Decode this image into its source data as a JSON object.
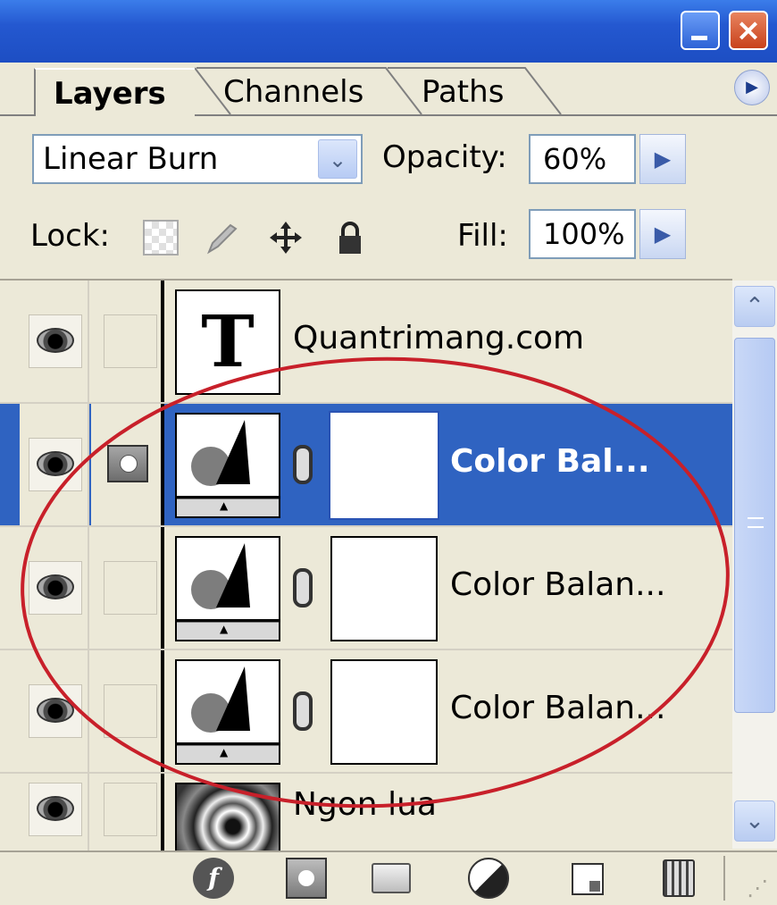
{
  "tabs": [
    {
      "label": "Layers",
      "active": true
    },
    {
      "label": "Channels",
      "active": false
    },
    {
      "label": "Paths",
      "active": false
    }
  ],
  "blend_mode": {
    "value": "Linear Burn"
  },
  "opacity": {
    "label": "Opacity:",
    "value": "60%"
  },
  "lock": {
    "label": "Lock:"
  },
  "fill": {
    "label": "Fill:",
    "value": "100%"
  },
  "layers": [
    {
      "name": "Quantrimang.com",
      "type": "text",
      "thumb_glyph": "T",
      "visible": true,
      "selected": false
    },
    {
      "name": "Color Bal...",
      "type": "adjustment",
      "visible": true,
      "selected": true
    },
    {
      "name": "Color Balan...",
      "type": "adjustment",
      "visible": true,
      "selected": false
    },
    {
      "name": "Color Balan...",
      "type": "adjustment",
      "visible": true,
      "selected": false
    },
    {
      "name": "Ngon lua",
      "type": "image",
      "visible": true,
      "selected": false
    }
  ],
  "icons": {
    "minimize": "minimize-icon",
    "close": "close-icon",
    "panel_menu": "panel-menu-icon",
    "lock_transparent": "lock-transparent-pixels-icon",
    "lock_image": "lock-image-pixels-icon",
    "lock_position": "lock-position-icon",
    "lock_all": "lock-all-icon",
    "fx": "layer-style-icon",
    "add_mask": "add-mask-icon",
    "new_group": "new-group-icon",
    "adjustment": "new-adjustment-layer-icon",
    "new_layer": "new-layer-icon",
    "delete": "delete-layer-icon"
  },
  "colors": {
    "selection": "#2f63c1",
    "annotation": "#c8202a",
    "panel_bg": "#ece9d8"
  }
}
